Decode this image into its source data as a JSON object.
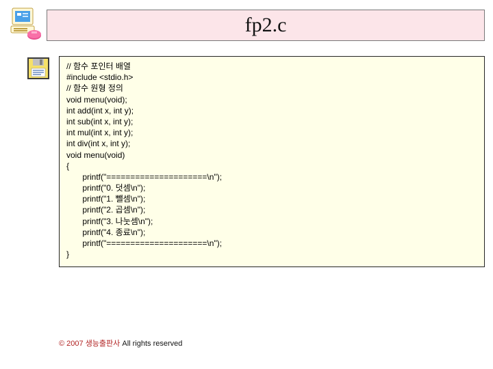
{
  "title": "fp2.c",
  "code": {
    "l01": "// 함수 포인터 배열",
    "l02": "#include <stdio.h>",
    "l03": "",
    "l04": "// 함수 원형 정의",
    "l05": "void menu(void);",
    "l06": "int add(int x, int y);",
    "l07": "int sub(int x, int y);",
    "l08": "int mul(int x, int y);",
    "l09": "int div(int x, int y);",
    "l10": "",
    "l11": "void menu(void)",
    "l12": "{",
    "l13": "       printf(\"=====================\\n\");",
    "l14": "       printf(\"0. 덧셈\\n\");",
    "l15": "       printf(\"1. 뺄셈\\n\");",
    "l16": "       printf(\"2. 곱셈\\n\");",
    "l17": "       printf(\"3. 나눗셈\\n\");",
    "l18": "       printf(\"4. 종료\\n\");",
    "l19": "       printf(\"=====================\\n\");",
    "l20": "}"
  },
  "footer": {
    "copyright": "© 2007 생능출판사",
    "rights": "  All rights reserved"
  }
}
